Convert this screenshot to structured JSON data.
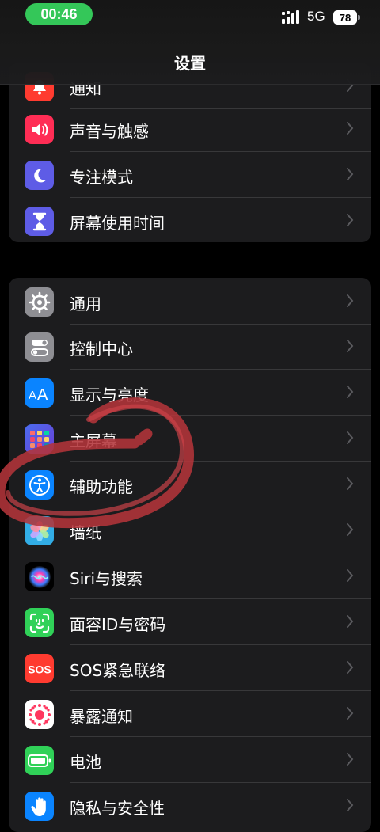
{
  "status_bar": {
    "time": "00:46",
    "network": "5G",
    "battery": "78"
  },
  "nav": {
    "title": "设置"
  },
  "group1": [
    {
      "label": "通知",
      "icon": "bell-icon",
      "color": "#ff3b30"
    },
    {
      "label": "声音与触感",
      "icon": "speaker-icon",
      "color": "#ff2d55"
    },
    {
      "label": "专注模式",
      "icon": "moon-icon",
      "color": "#5e5ce6"
    },
    {
      "label": "屏幕使用时间",
      "icon": "hourglass-icon",
      "color": "#5e5ce6"
    }
  ],
  "group2": [
    {
      "label": "通用",
      "icon": "gear-icon",
      "color": "#8e8e93"
    },
    {
      "label": "控制中心",
      "icon": "toggles-icon",
      "color": "#8e8e93"
    },
    {
      "label": "显示与亮度",
      "icon": "text-size-icon",
      "color": "#0a84ff"
    },
    {
      "label": "主屏幕",
      "icon": "home-grid-icon",
      "color": "#3a5fd9"
    },
    {
      "label": "辅助功能",
      "icon": "accessibility-icon",
      "color": "#0a84ff"
    },
    {
      "label": "墙纸",
      "icon": "flower-icon",
      "color": "#32ade6"
    },
    {
      "label": "Siri与搜索",
      "icon": "siri-icon",
      "color": "#1c1c1e"
    },
    {
      "label": "面容ID与密码",
      "icon": "face-id-icon",
      "color": "#30d158"
    },
    {
      "label": "SOS紧急联络",
      "icon": "sos-icon",
      "color": "#ff3b30"
    },
    {
      "label": "暴露通知",
      "icon": "exposure-icon",
      "color": "#ffffff"
    },
    {
      "label": "电池",
      "icon": "battery-icon",
      "color": "#30d158"
    },
    {
      "label": "隐私与安全性",
      "icon": "hand-icon",
      "color": "#0a84ff"
    }
  ],
  "annotation": {
    "color": "#b3343a"
  }
}
